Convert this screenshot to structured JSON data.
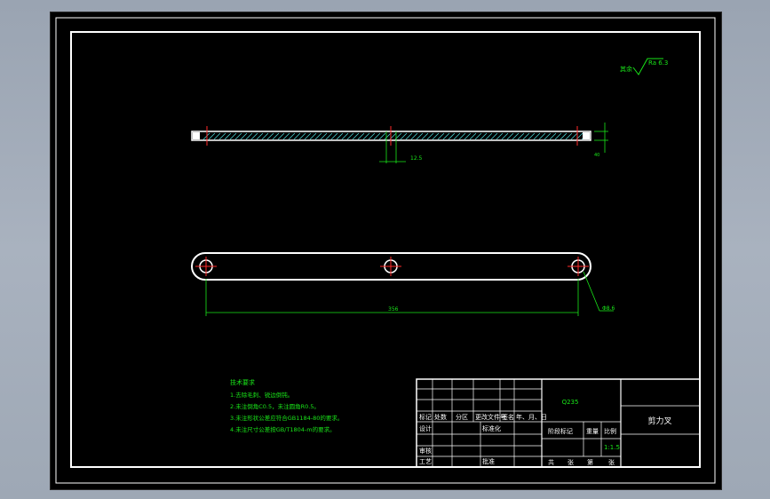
{
  "roughness_note": {
    "label": "其余",
    "value": "Ra 6.3"
  },
  "dimensions": {
    "thickness": "12.5",
    "length": "356",
    "hole_dia": "Φ8.6",
    "height": "40"
  },
  "tech_requirements": {
    "title": "技术要求",
    "items": [
      "1.去除毛刺、锐边倒钝。",
      "2.未注倒角C0.5，未注圆角R0.5。",
      "3.未注形状公差应符合GB1184-80的要求。",
      "4.未注尺寸公差按GB/T1804-m的要求。"
    ]
  },
  "title_block": {
    "material": "Q235",
    "part_name": "剪力叉",
    "rev_headers": [
      "标记",
      "处数",
      "分区",
      "更改文件号",
      "签名",
      "年、月、日"
    ],
    "design": "设计",
    "standard": "标准化",
    "review": "审核",
    "process": "工艺",
    "approve": "批准",
    "stage_mark": "阶段标记",
    "weight": "重量",
    "scale_label": "比例",
    "scale": "1:1.5",
    "sheets": [
      "共",
      "张",
      "第",
      "张"
    ]
  },
  "colors": {
    "background": "#000000",
    "outline": "#ffffff",
    "annotation": "#19e619",
    "centerline": "#ff2a2a",
    "hatch": "#4ad0d0"
  }
}
